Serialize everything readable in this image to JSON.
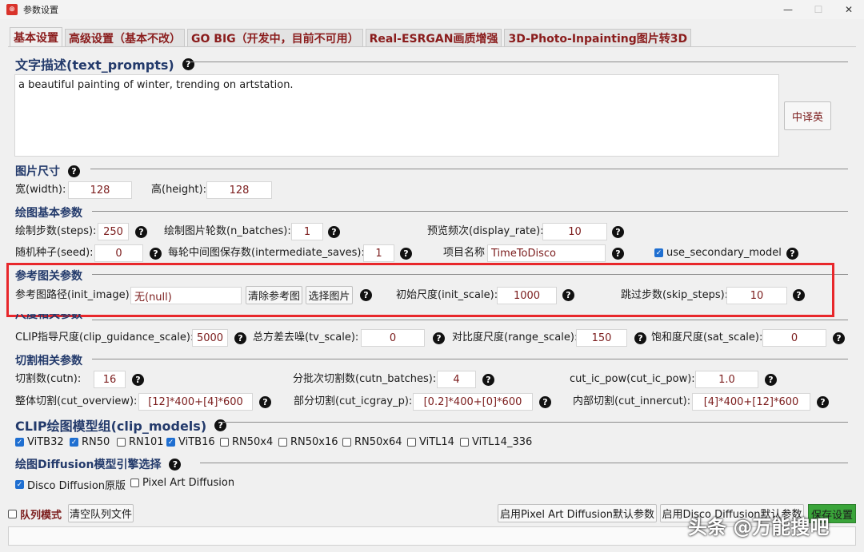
{
  "window": {
    "title": "参数设置",
    "min": "—",
    "max": "☐",
    "close": "✕"
  },
  "tabs": [
    "基本设置",
    "高级设置（基本不改）",
    "GO BIG（开发中，目前不可用）",
    "Real-ESRGAN画质增强",
    "3D-Photo-Inpainting图片转3D"
  ],
  "text_prompts": {
    "title": "文字描述(text_prompts)",
    "value": "a beautiful painting of winter, trending on artstation.",
    "translate_btn": "中译英"
  },
  "size": {
    "title": "图片尺寸",
    "width_label": "宽(width):",
    "width": "128",
    "height_label": "高(height):",
    "height": "128"
  },
  "basic": {
    "title": "绘图基本参数",
    "steps_label": "绘制步数(steps):",
    "steps": "250",
    "n_batches_label": "绘制图片轮数(n_batches):",
    "n_batches": "1",
    "display_rate_label": "预览频次(display_rate):",
    "display_rate": "10",
    "seed_label": "随机种子(seed):",
    "seed": "0",
    "intermediate_label": "每轮中间图保存数(intermediate_saves):",
    "intermediate": "1",
    "project_label": "项目名称",
    "project": "TimeToDisco",
    "secondary_label": "use_secondary_model"
  },
  "init": {
    "title": "参考图关参数",
    "path_label": "参考图路径(init_image):",
    "path": "无(null)",
    "clear_btn": "清除参考图",
    "choose_btn": "选择图片",
    "scale_label": "初始尺度(init_scale):",
    "scale": "1000",
    "skip_label": "跳过步数(skip_steps):",
    "skip": "10"
  },
  "scale": {
    "title": "尺度相关参数",
    "clip_label": "CLIP指导尺度(clip_guidance_scale):",
    "clip": "5000",
    "tv_label": "总方差去噪(tv_scale):",
    "tv": "0",
    "range_label": "对比度尺度(range_scale):",
    "range": "150",
    "sat_label": "饱和度尺度(sat_scale):",
    "sat": "0"
  },
  "cut": {
    "title": "切割相关参数",
    "cutn_label": "切割数(cutn):",
    "cutn": "16",
    "batches_label": "分批次切割数(cutn_batches):",
    "batches": "4",
    "pow_label": "cut_ic_pow(cut_ic_pow):",
    "pow": "1.0",
    "overview_label": "整体切割(cut_overview):",
    "overview": "[12]*400+[4]*600",
    "icgray_label": "部分切割(cut_icgray_p):",
    "icgray": "[0.2]*400+[0]*600",
    "inner_label": "内部切割(cut_innercut):",
    "inner": "[4]*400+[12]*600"
  },
  "clip_models": {
    "title": "CLIP绘图模型组(clip_models)",
    "items": [
      {
        "label": "ViTB32",
        "checked": true
      },
      {
        "label": "RN50",
        "checked": true
      },
      {
        "label": "RN101",
        "checked": false
      },
      {
        "label": "ViTB16",
        "checked": true
      },
      {
        "label": "RN50x4",
        "checked": false
      },
      {
        "label": "RN50x16",
        "checked": false
      },
      {
        "label": "RN50x64",
        "checked": false
      },
      {
        "label": "ViTL14",
        "checked": false
      },
      {
        "label": "ViTL14_336",
        "checked": false
      }
    ]
  },
  "diffusion": {
    "title": "绘图Diffusion模型引擎选择",
    "disco": "Disco Diffusion原版",
    "pixel": "Pixel Art Diffusion"
  },
  "footer": {
    "queue_mode": "队列模式",
    "clear_queue": "清空队列文件",
    "pixel_default": "启用Pixel Art Diffusion默认参数",
    "disco_default": "启用Disco Diffusion默认参数",
    "save": "保存设置"
  },
  "watermark": "头条 @万能搜吧",
  "help_glyph": "?",
  "check_glyph": "✓",
  "colors": {
    "accent_red": "#e8272b",
    "value_text": "#7b1c1c",
    "section_text": "#233a6b",
    "save_green": "#3aa53a"
  }
}
